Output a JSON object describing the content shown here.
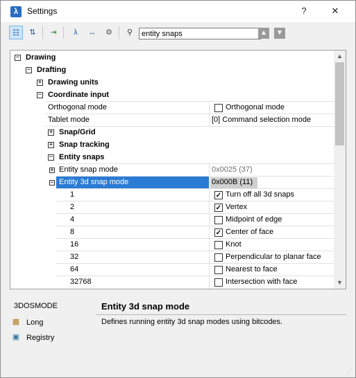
{
  "window": {
    "title": "Settings",
    "help_label": "?",
    "close_label": "✕",
    "app_icon": "λ"
  },
  "toolbar": {
    "search_value": "entity snaps",
    "icons": [
      "categorized-view-icon",
      "alphabetic-view-icon",
      "export-icon",
      "drawing-settings-icon",
      "dimension-settings-icon",
      "system-settings-icon",
      "binoculars-icon"
    ],
    "prev_label": "▲",
    "next_label": "▼"
  },
  "tree": {
    "drawing": "Drawing",
    "drafting": "Drafting",
    "drawing_units": "Drawing units",
    "coordinate_input": "Coordinate input",
    "orthogonal_mode_name": "Orthogonal mode",
    "orthogonal_mode_value": "Orthogonal mode",
    "tablet_mode_name": "Tablet mode",
    "tablet_mode_value": "[0] Command selection mode",
    "snap_grid": "Snap/Grid",
    "snap_tracking": "Snap tracking",
    "entity_snaps": "Entity snaps",
    "entity_snap_mode_name": "Entity snap mode",
    "entity_snap_mode_value": "0x0025 (37)",
    "entity_3d_snap_mode_name": "Entity 3d snap mode",
    "entity_3d_snap_mode_value": "0x000B (11)",
    "bits": [
      {
        "bit": "1",
        "label": "Turn off all 3d snaps",
        "checked": true
      },
      {
        "bit": "2",
        "label": "Vertex",
        "checked": true
      },
      {
        "bit": "4",
        "label": "Midpoint of edge",
        "checked": false
      },
      {
        "bit": "8",
        "label": "Center of face",
        "checked": true
      },
      {
        "bit": "16",
        "label": "Knot",
        "checked": false
      },
      {
        "bit": "32",
        "label": "Perpendicular to planar face",
        "checked": false
      },
      {
        "bit": "64",
        "label": "Nearest to face",
        "checked": false
      },
      {
        "bit": "32768",
        "label": "Intersection with face",
        "checked": false
      }
    ]
  },
  "details": {
    "variable": "3DOSMODE",
    "type": "Long",
    "storage": "Registry",
    "title": "Entity 3d snap mode",
    "description": "Defines running entity 3d snap modes using bitcodes."
  },
  "colors": {
    "selection": "#2a7bd4",
    "selected_value_bg": "#cfcfcf"
  }
}
